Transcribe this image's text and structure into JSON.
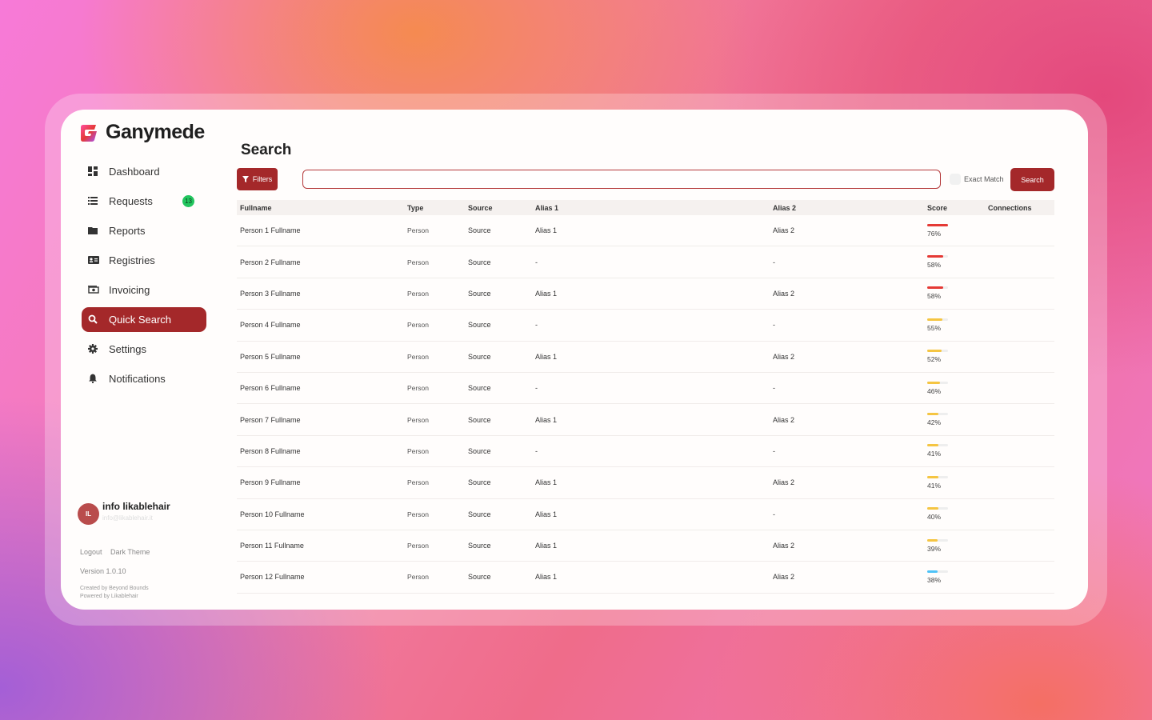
{
  "app": {
    "name": "Ganymede"
  },
  "sidebar": {
    "items": [
      {
        "label": "Dashboard",
        "icon": "dashboard-icon",
        "active": false
      },
      {
        "label": "Requests",
        "icon": "list-icon",
        "active": false,
        "badge": "13"
      },
      {
        "label": "Reports",
        "icon": "folder-icon",
        "active": false
      },
      {
        "label": "Registries",
        "icon": "id-card-icon",
        "active": false
      },
      {
        "label": "Invoicing",
        "icon": "money-icon",
        "active": false
      },
      {
        "label": "Quick Search",
        "icon": "search-icon",
        "active": true
      },
      {
        "label": "Settings",
        "icon": "gear-icon",
        "active": false
      },
      {
        "label": "Notifications",
        "icon": "bell-icon",
        "active": false
      }
    ],
    "user": {
      "initials": "IL",
      "name": "info likablehair",
      "email": "info@likablehair.it"
    },
    "footer": {
      "logout": "Logout",
      "theme": "Dark Theme",
      "version": "Version 1.0.10",
      "created_by": "Created by Beyond Bounds",
      "powered_by": "Powered by Likablehair"
    }
  },
  "main": {
    "title": "Search",
    "filters_label": "Filters",
    "search_value": "",
    "search_placeholder": "",
    "exact_match_label": "Exact Match",
    "search_button": "Search",
    "columns": [
      "Fullname",
      "Type",
      "Source",
      "Alias 1",
      "Alias 2",
      "Score",
      "Connections"
    ],
    "rows": [
      {
        "name": "Person 1 Fullname",
        "type": "Person",
        "source": "Source",
        "alias1": "Alias 1",
        "alias2": "Alias 2",
        "score": "76%",
        "score_value": 76,
        "score_color": "#e53935"
      },
      {
        "name": "Person 2 Fullname",
        "type": "Person",
        "source": "Source",
        "alias1": "-",
        "alias2": "-",
        "score": "58%",
        "score_value": 58,
        "score_color": "#e53935"
      },
      {
        "name": "Person 3 Fullname",
        "type": "Person",
        "source": "Source",
        "alias1": "Alias 1",
        "alias2": "Alias 2",
        "score": "58%",
        "score_value": 58,
        "score_color": "#e53935"
      },
      {
        "name": "Person 4 Fullname",
        "type": "Person",
        "source": "Source",
        "alias1": "-",
        "alias2": "-",
        "score": "55%",
        "score_value": 55,
        "score_color": "#f5c542"
      },
      {
        "name": "Person 5 Fullname",
        "type": "Person",
        "source": "Source",
        "alias1": "Alias 1",
        "alias2": "Alias 2",
        "score": "52%",
        "score_value": 52,
        "score_color": "#f5c542"
      },
      {
        "name": "Person 6 Fullname",
        "type": "Person",
        "source": "Source",
        "alias1": "-",
        "alias2": "-",
        "score": "46%",
        "score_value": 46,
        "score_color": "#f5c542"
      },
      {
        "name": "Person 7 Fullname",
        "type": "Person",
        "source": "Source",
        "alias1": "Alias 1",
        "alias2": "Alias 2",
        "score": "42%",
        "score_value": 42,
        "score_color": "#f5c542"
      },
      {
        "name": "Person 8 Fullname",
        "type": "Person",
        "source": "Source",
        "alias1": "-",
        "alias2": "-",
        "score": "41%",
        "score_value": 41,
        "score_color": "#f5c542"
      },
      {
        "name": "Person 9 Fullname",
        "type": "Person",
        "source": "Source",
        "alias1": "Alias 1",
        "alias2": "Alias 2",
        "score": "41%",
        "score_value": 41,
        "score_color": "#f5c542"
      },
      {
        "name": "Person 10 Fullname",
        "type": "Person",
        "source": "Source",
        "alias1": "Alias 1",
        "alias2": "-",
        "score": "40%",
        "score_value": 40,
        "score_color": "#f5c542"
      },
      {
        "name": "Person 11 Fullname",
        "type": "Person",
        "source": "Source",
        "alias1": "Alias 1",
        "alias2": "Alias 2",
        "score": "39%",
        "score_value": 39,
        "score_color": "#f5c542"
      },
      {
        "name": "Person 12 Fullname",
        "type": "Person",
        "source": "Source",
        "alias1": "Alias 1",
        "alias2": "Alias 2",
        "score": "38%",
        "score_value": 38,
        "score_color": "#4fc3f7"
      }
    ]
  },
  "colors": {
    "accent": "#a4282a",
    "badge": "#22c55e"
  }
}
